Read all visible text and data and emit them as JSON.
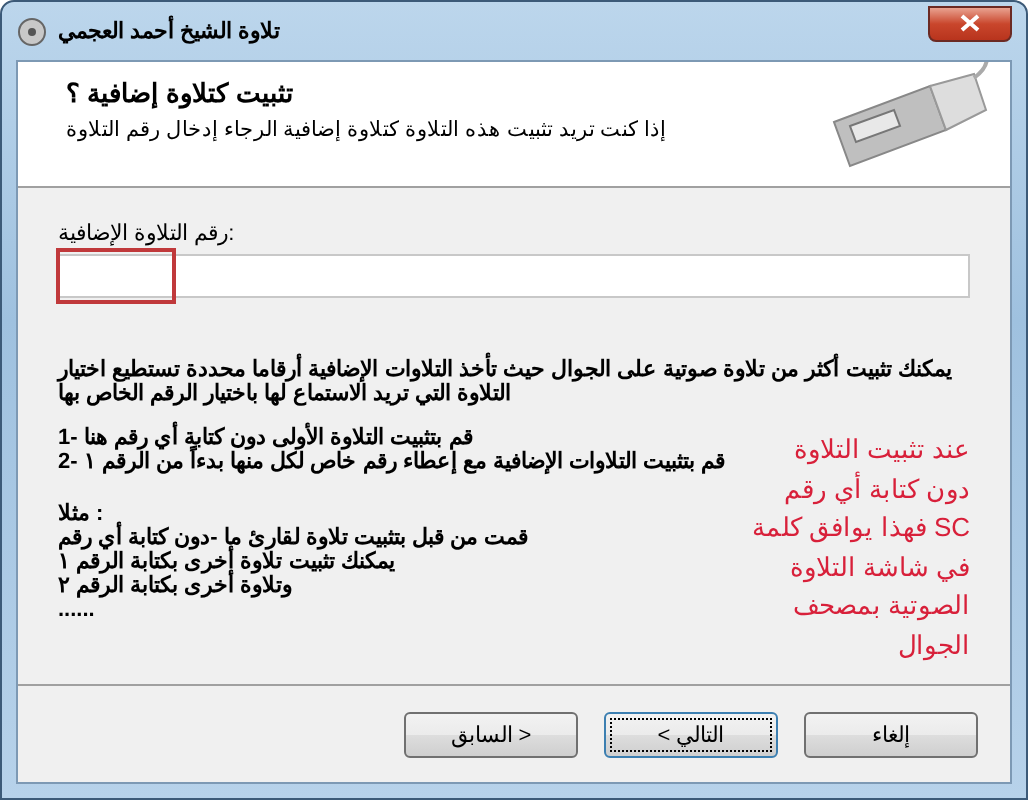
{
  "window": {
    "title": "تلاوة الشيخ أحمد العجمي"
  },
  "header": {
    "title": "تثبيت كتلاوة إضافية ؟",
    "subtitle": "إذا كنت تريد تثبيت هذه التلاوة كتلاوة إضافية الرجاء إدخال رقم التلاوة"
  },
  "field": {
    "label": "رقم التلاوة الإضافية:",
    "highlighted": true
  },
  "intro": [
    "يمكنك تثبيت أكثر من تلاوة صوتية على الجوال حيث تأخذ التلاوات الإضافية أرقاما محددة تستطيع اختيار",
    "التلاوة التي تريد الاستماع لها باختيار الرقم الخاص بها"
  ],
  "steps": [
    "قم بتثبيت التلاوة الأولى دون كتابة أي رقم هنا -1",
    "قم بتثبيت التلاوات الإضافية مع إعطاء رقم خاص لكل منها بدءاً من الرقم ١ -2"
  ],
  "example": [
    "مثلا :",
    "قمت من قبل بتثبيت تلاوة لقارئ ما -دون كتابة أي رقم",
    "يمكنك تثبيت تلاوة أخرى بكتابة الرقم ١",
    "وتلاوة أخرى بكتابة الرقم ٢",
    "......"
  ],
  "annotation": [
    "عند تثبيت التلاوة",
    "دون كتابة أي رقم",
    "فهذا يوافق كلمة SC",
    "في شاشة التلاوة",
    "الصوتية بمصحف",
    "الجوال"
  ],
  "buttons": [
    {
      "label": "إلغاء",
      "focused": false
    },
    {
      "label": "< التالي",
      "focused": true
    },
    {
      "label": "السابق >",
      "focused": false
    }
  ]
}
